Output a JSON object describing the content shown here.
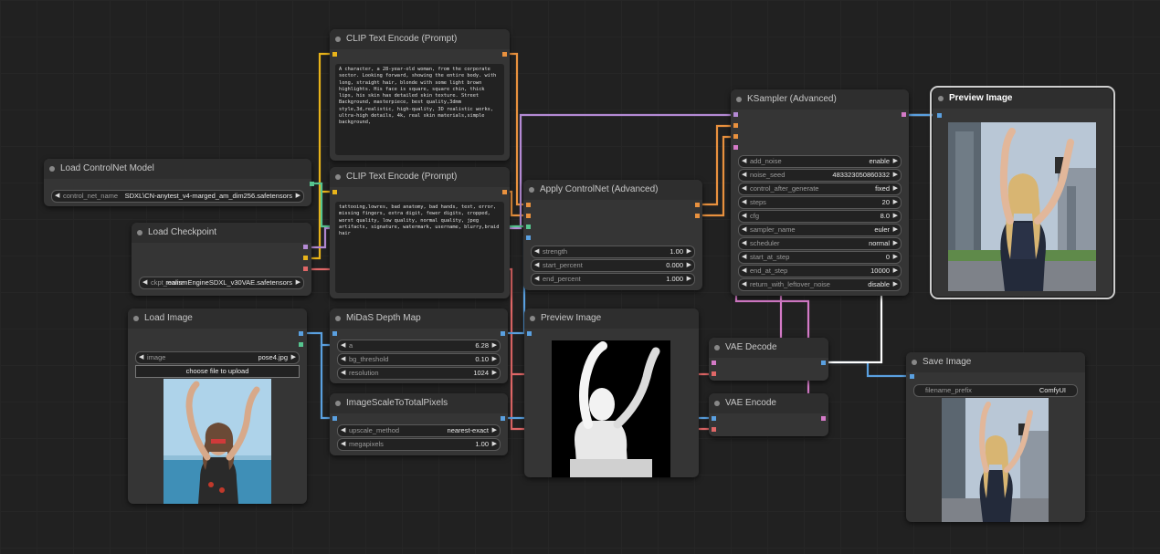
{
  "colors": {
    "canvas": "#212121",
    "node": "#353535",
    "yellow_link": "#e8b31a",
    "orange_link": "#e9913e",
    "purple_link": "#b48ad4",
    "pink_link": "#d47ac7",
    "red_link": "#e06767",
    "blue_link": "#5aa0e0",
    "green_link": "#56c58f",
    "white_link": "#ffffff"
  },
  "nodes": {
    "load_controlnet": {
      "title": "Load ControlNet Model",
      "widgets": [
        {
          "label": "control_net_name",
          "value": "SDXL\\CN-anytest_v4-marged_am_dim256.safetensors"
        }
      ]
    },
    "load_checkpoint": {
      "title": "Load Checkpoint",
      "widgets": [
        {
          "label": "ckpt_name",
          "value": "realismEngineSDXL_v30VAE.safetensors"
        }
      ]
    },
    "clip_pos": {
      "title": "CLIP Text Encode (Prompt)",
      "text": "A character, a 28-year-old woman, from the corporate sector. Looking forward, showing the entire body. with long, straight hair, blonde with some light brown highlights. His face is square, square chin, thick lips, his skin has detailed skin texture. Street Background, masterpiece, best quality,3dmm style,3d,realistic, high-quality, 3D realistic works, ultra-high details, 4k, real skin materials,simple background,"
    },
    "clip_neg": {
      "title": "CLIP Text Encode (Prompt)",
      "text": "tattooing,lowres, bad anatomy, bad hands, text, error, missing fingers, extra digit, fewer digits, cropped, worst quality, low quality, normal quality, jpeg artifacts, signature, watermark, username, blurry,braid hair"
    },
    "apply_controlnet": {
      "title": "Apply ControlNet (Advanced)",
      "widgets": [
        {
          "label": "strength",
          "value": "1.00"
        },
        {
          "label": "start_percent",
          "value": "0.000"
        },
        {
          "label": "end_percent",
          "value": "1.000"
        }
      ]
    },
    "ksampler": {
      "title": "KSampler (Advanced)",
      "widgets": [
        {
          "label": "add_noise",
          "value": "enable"
        },
        {
          "label": "noise_seed",
          "value": "483323050860332"
        },
        {
          "label": "control_after_generate",
          "value": "fixed"
        },
        {
          "label": "steps",
          "value": "20"
        },
        {
          "label": "cfg",
          "value": "8.0"
        },
        {
          "label": "sampler_name",
          "value": "euler"
        },
        {
          "label": "scheduler",
          "value": "normal"
        },
        {
          "label": "start_at_step",
          "value": "0"
        },
        {
          "label": "end_at_step",
          "value": "10000"
        },
        {
          "label": "return_with_leftover_noise",
          "value": "disable"
        }
      ]
    },
    "preview_top": {
      "title": "Preview Image"
    },
    "load_image": {
      "title": "Load Image",
      "widgets": [
        {
          "label": "image",
          "value": "pose4.jpg"
        }
      ],
      "upload_label": "choose file to upload"
    },
    "midas": {
      "title": "MiDaS Depth Map",
      "widgets": [
        {
          "label": "a",
          "value": "6.28"
        },
        {
          "label": "bg_threshold",
          "value": "0.10"
        },
        {
          "label": "resolution",
          "value": "1024"
        }
      ]
    },
    "scale": {
      "title": "ImageScaleToTotalPixels",
      "widgets": [
        {
          "label": "upscale_method",
          "value": "nearest-exact"
        },
        {
          "label": "megapixels",
          "value": "1.00"
        }
      ]
    },
    "preview_mid": {
      "title": "Preview Image"
    },
    "vae_decode": {
      "title": "VAE Decode"
    },
    "vae_encode": {
      "title": "VAE Encode"
    },
    "save_image": {
      "title": "Save Image",
      "widgets": [
        {
          "label": "filename_prefix",
          "value": "ComfyUI"
        }
      ]
    }
  }
}
